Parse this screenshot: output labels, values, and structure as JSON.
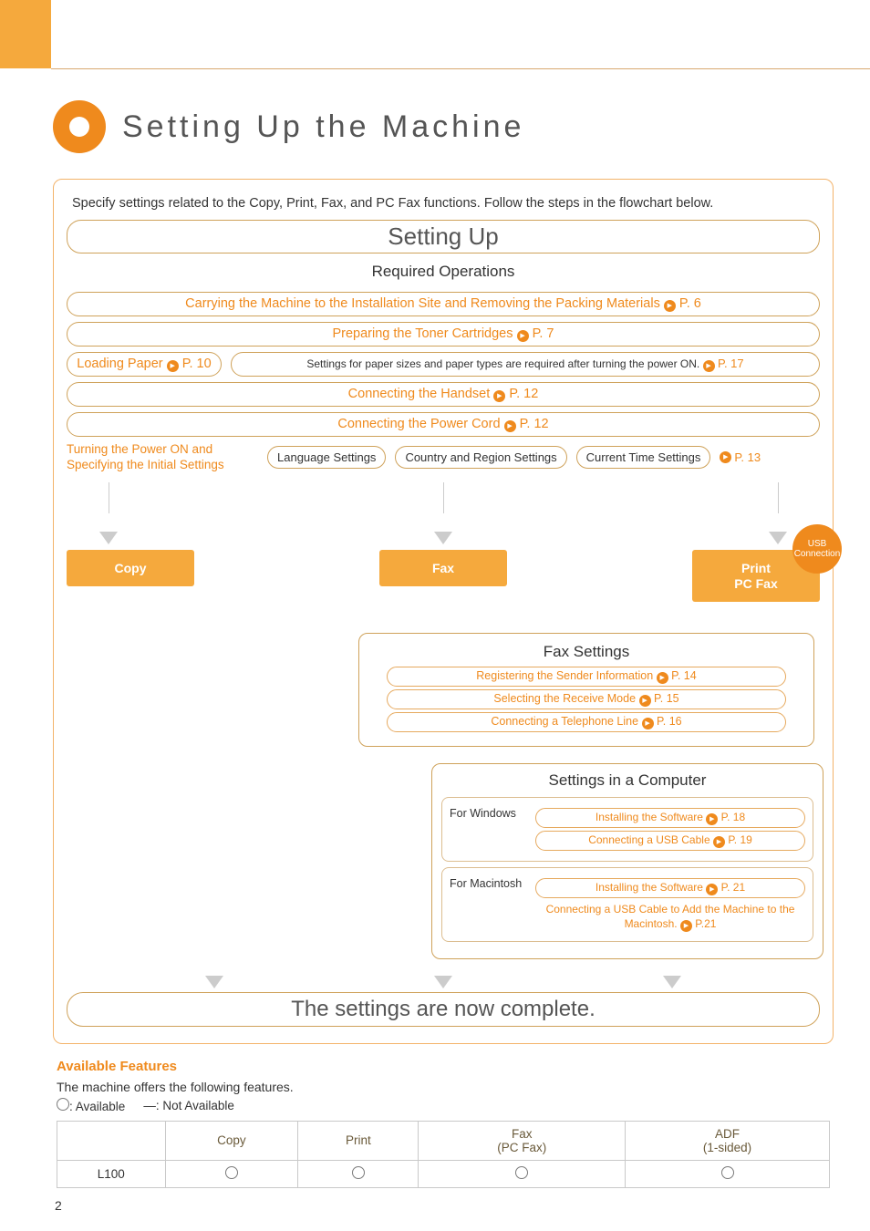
{
  "title": "Setting Up the Machine",
  "intro": "Specify settings related to the Copy, Print, Fax, and PC Fax functions. Follow the steps in the flowchart below.",
  "setting_up": "Setting Up",
  "required_ops": "Required Operations",
  "steps": {
    "carry": "Carrying the Machine to the Installation Site and Removing the Packing Materials",
    "carry_p": "P. 6",
    "toner": "Preparing the Toner Cartridges",
    "toner_p": "P. 7",
    "load_paper": "Loading Paper",
    "load_paper_p": "P. 10",
    "paper_note": "Settings for paper sizes and paper types are required after turning the power ON.",
    "paper_note_p": "P. 17",
    "handset": "Connecting the Handset",
    "handset_p": "P. 12",
    "power_cord": "Connecting the Power Cord",
    "power_cord_p": "P. 12",
    "power_on_label": "Turning the Power ON and Specifying the Initial Settings",
    "lang": "Language Settings",
    "country": "Country and Region Settings",
    "time": "Current Time Settings",
    "time_p": "P. 13"
  },
  "funcs": {
    "copy": "Copy",
    "fax": "Fax",
    "print": "Print",
    "pcfax": "PC Fax",
    "usb_top": "USB",
    "usb_bottom": "Connection"
  },
  "fax_settings": {
    "title": "Fax Settings",
    "sender": "Registering the Sender Information",
    "sender_p": "P. 14",
    "receive": "Selecting the Receive Mode",
    "receive_p": "P. 15",
    "line": "Connecting a Telephone Line",
    "line_p": "P. 16"
  },
  "computer": {
    "title": "Settings in a Computer",
    "win": "For Windows",
    "win_install": "Installing the Software",
    "win_install_p": "P. 18",
    "win_usb": "Connecting a USB Cable",
    "win_usb_p": "P. 19",
    "mac": "For Macintosh",
    "mac_install": "Installing the Software",
    "mac_install_p": "P. 21",
    "mac_usb": "Connecting a USB Cable to Add the Machine to the Macintosh.",
    "mac_usb_p": "P.21"
  },
  "complete": "The settings are now complete.",
  "features": {
    "title": "Available Features",
    "desc": "The machine offers the following features.",
    "legend_avail": ": Available",
    "legend_na": ": Not Available",
    "cols": {
      "copy": "Copy",
      "print": "Print",
      "fax": "Fax",
      "fax_sub": "(PC Fax)",
      "adf": "ADF",
      "adf_sub": "(1-sided)"
    },
    "row_model": "L100"
  },
  "page_number": "2"
}
